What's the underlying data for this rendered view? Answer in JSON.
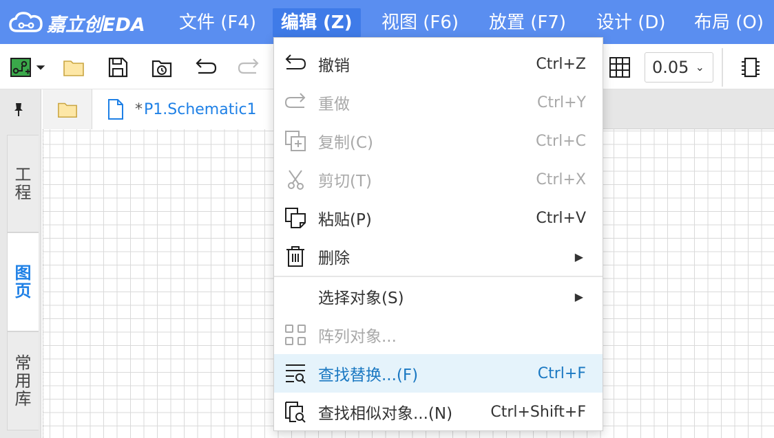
{
  "brand": {
    "name": "嘉立创EDA"
  },
  "menubar": {
    "items": [
      {
        "label": "文件 (F4)"
      },
      {
        "label": "编辑 (Z)",
        "active": true
      },
      {
        "label": "视图 (F6)"
      },
      {
        "label": "放置 (F7)"
      },
      {
        "label": "设计 (D)"
      },
      {
        "label": "布局 (O)"
      }
    ]
  },
  "toolbar": {
    "grid_size": "0.05",
    "icons": [
      "new-project-icon",
      "chevron-down-icon",
      "open-folder-icon",
      "save-icon",
      "history-icon",
      "undo-icon",
      "redo-icon",
      "grid-icon",
      "component-icon"
    ]
  },
  "left_panel": {
    "tabs": [
      {
        "label": "工程"
      },
      {
        "label": "图页",
        "active": true
      },
      {
        "label": "常用库"
      }
    ]
  },
  "tabbar": {
    "doc_tab_star": "*",
    "doc_tab_name": "P1.Schematic1"
  },
  "edit_menu": {
    "items": [
      {
        "label": "撤销",
        "shortcut": "Ctrl+Z",
        "icon": "undo-icon",
        "enabled": true
      },
      {
        "label": "重做",
        "shortcut": "Ctrl+Y",
        "icon": "redo-icon",
        "enabled": false
      },
      {
        "label": "复制(C)",
        "shortcut": "Ctrl+C",
        "icon": "copy-icon",
        "enabled": false
      },
      {
        "label": "剪切(T)",
        "shortcut": "Ctrl+X",
        "icon": "scissors-icon",
        "enabled": false
      },
      {
        "label": "粘贴(P)",
        "shortcut": "Ctrl+V",
        "icon": "paste-icon",
        "enabled": true
      },
      {
        "label": "删除",
        "icon": "trash-icon",
        "enabled": true,
        "submenu": true
      },
      {
        "label": "选择对象(S)",
        "enabled": true,
        "submenu": true
      },
      {
        "label": "阵列对象...",
        "icon": "array-icon",
        "enabled": false
      },
      {
        "label": "查找替换...(F)",
        "shortcut": "Ctrl+F",
        "icon": "find-replace-icon",
        "enabled": true,
        "highlighted": true
      },
      {
        "label": "查找相似对象...(N)",
        "shortcut": "Ctrl+Shift+F",
        "icon": "find-similar-icon",
        "enabled": true
      }
    ]
  },
  "colors": {
    "menubar": "#5a8ef0",
    "menubar_active": "#3f7be8",
    "accent": "#1e80e6",
    "highlight_bg": "#e5f3fb",
    "highlight_text": "#1a78c2"
  }
}
